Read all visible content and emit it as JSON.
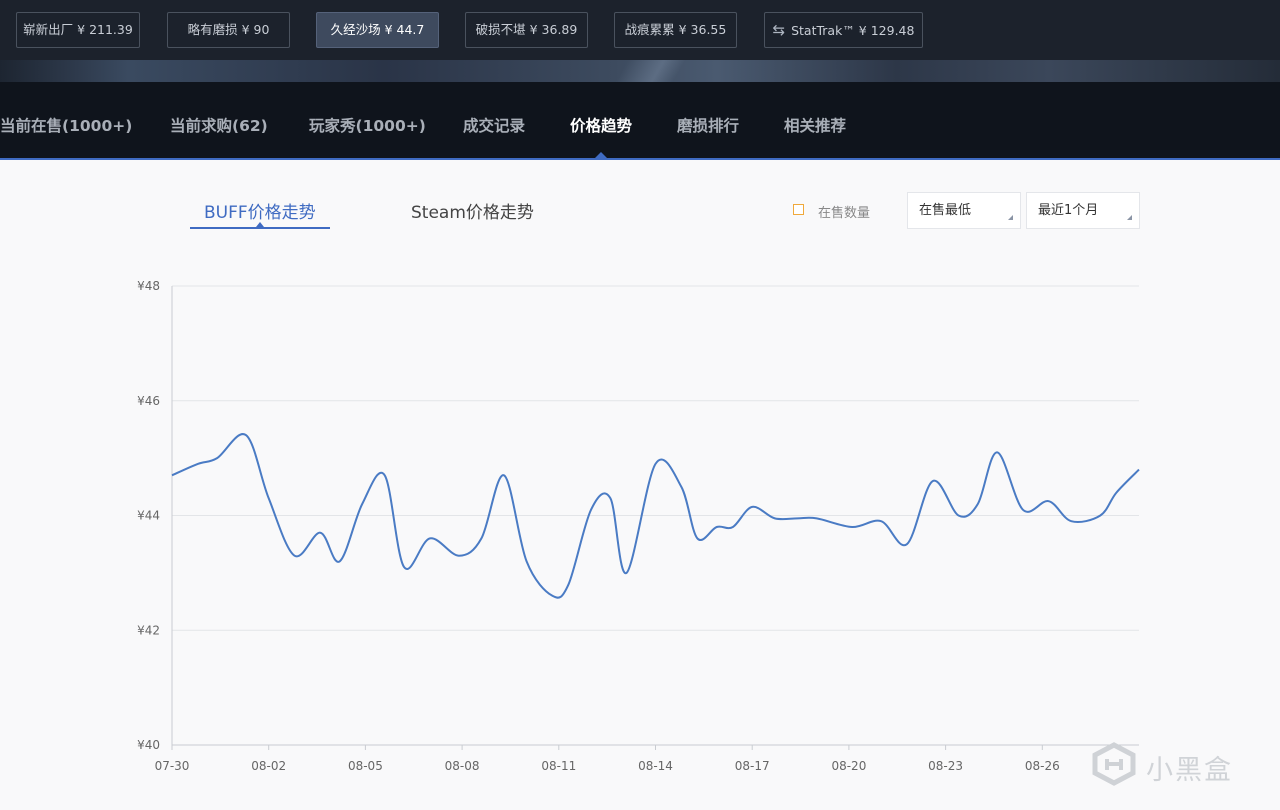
{
  "wear_bar": {
    "options": [
      {
        "label": "崭新出厂 ¥ 211.39",
        "active": false
      },
      {
        "label": "略有磨损 ¥ 90",
        "active": false
      },
      {
        "label": "久经沙场 ¥ 44.7",
        "active": true
      },
      {
        "label": "破损不堪 ¥ 36.89",
        "active": false
      },
      {
        "label": "战痕累累 ¥ 36.55",
        "active": false
      },
      {
        "label": "StatTrak™ ¥ 129.48",
        "active": false
      }
    ]
  },
  "tabs": [
    {
      "label": "当前在售(1000+)"
    },
    {
      "label": "当前求购(62)"
    },
    {
      "label": "玩家秀(1000+)"
    },
    {
      "label": "成交记录"
    },
    {
      "label": "价格趋势",
      "active": true
    },
    {
      "label": "磨损排行"
    },
    {
      "label": "相关推荐"
    }
  ],
  "chart_header": {
    "source_tabs": [
      {
        "label": "BUFF价格走势",
        "active": true
      },
      {
        "label": "Steam价格走势",
        "active": false
      }
    ],
    "legend_label": "在售数量",
    "price_type_select": "在售最低",
    "range_select": "最近1个月"
  },
  "colors": {
    "accent": "#3f6bc2",
    "line": "#4a7bc4",
    "legend_box": "#f0a93b",
    "top_bar": "#1c222c",
    "tab_bar": "#0f141c"
  },
  "chart_data": {
    "type": "line",
    "title": "",
    "xlabel": "",
    "ylabel": "",
    "ylim": [
      40,
      48
    ],
    "y_ticks": [
      40,
      42,
      44,
      46,
      48
    ],
    "y_tick_labels": [
      "¥40",
      "¥42",
      "¥44",
      "¥46",
      "¥48"
    ],
    "x_tick_labels": [
      "07-30",
      "08-02",
      "08-05",
      "08-08",
      "08-11",
      "08-14",
      "08-17",
      "08-20",
      "08-23",
      "08-26"
    ],
    "x_range": [
      0,
      30
    ],
    "grid": true,
    "series": [
      {
        "name": "",
        "x": [
          0,
          0.8,
          1.4,
          2.3,
          3.0,
          3.8,
          4.6,
          5.2,
          5.9,
          6.6,
          7.2,
          8.0,
          8.9,
          9.6,
          10.3,
          11.0,
          11.8,
          12.3,
          13.0,
          13.6,
          14.1,
          15.0,
          15.8,
          16.3,
          16.9,
          17.4,
          18.0,
          18.7,
          19.4,
          20.0,
          21.1,
          22.0,
          22.8,
          23.6,
          24.4,
          25.0,
          25.6,
          26.4,
          27.2,
          27.9,
          28.8,
          29.3,
          30.0
        ],
        "y": [
          44.7,
          44.9,
          45.0,
          45.4,
          44.3,
          43.3,
          43.7,
          43.2,
          44.2,
          44.7,
          43.1,
          43.6,
          43.3,
          43.6,
          44.7,
          43.2,
          42.6,
          42.8,
          44.1,
          44.3,
          43.0,
          44.9,
          44.5,
          43.6,
          43.8,
          43.8,
          44.15,
          43.95,
          43.95,
          43.95,
          43.8,
          43.9,
          43.5,
          44.6,
          44.0,
          44.2,
          45.1,
          44.1,
          44.25,
          43.9,
          44.0,
          44.4,
          44.8
        ]
      }
    ]
  },
  "watermark": "小黑盒"
}
